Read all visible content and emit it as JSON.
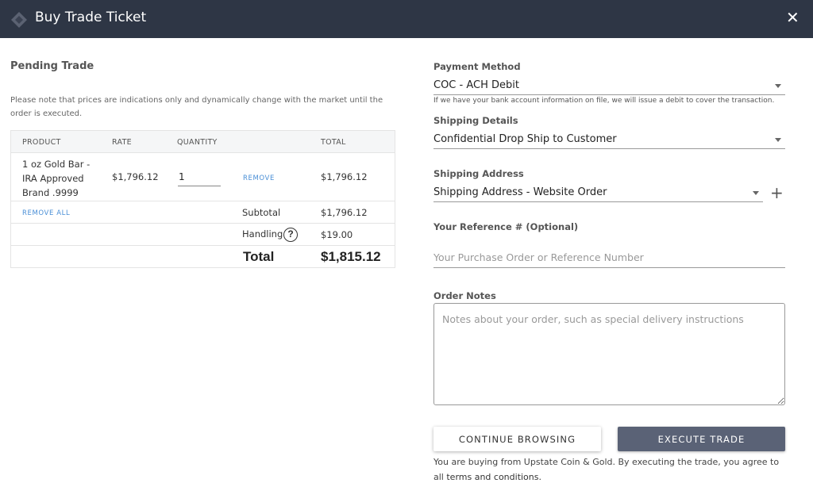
{
  "header": {
    "title": "Buy Trade Ticket",
    "close_label": "✕",
    "logo_icon": "diamond-logo-icon"
  },
  "pending": {
    "title": "Pending Trade",
    "note": "Please note that prices are indications only and dynamically change with the market until the order is executed.",
    "columns": [
      "PRODUCT",
      "RATE",
      "QUANTITY",
      "TOTAL"
    ],
    "item": {
      "product": "1 oz Gold Bar - IRA Approved Brand .9999",
      "rate": "$1,796.12",
      "quantity": "1",
      "remove_label": "REMOVE",
      "total": "$1,796.12"
    },
    "remove_all_label": "REMOVE ALL",
    "subtotal_label": "Subtotal",
    "subtotal_value": "$1,796.12",
    "handling_label": "Handling",
    "handling_help": "?",
    "handling_value": "$19.00",
    "total_label": "Total",
    "total_value": "$1,815.12"
  },
  "payment": {
    "label": "Payment Method",
    "value": "COC - ACH Debit",
    "helper": "If we have your bank account information on file, we will issue a debit to cover the transaction."
  },
  "shipping_details": {
    "label": "Shipping Details",
    "value": "Confidential Drop Ship to Customer"
  },
  "shipping_address": {
    "label": "Shipping Address",
    "value": "Shipping Address - Website Order",
    "add_label": "+"
  },
  "reference": {
    "label": "Your Reference # (Optional)",
    "placeholder": "Your Purchase Order or Reference Number"
  },
  "order_notes": {
    "label": "Order Notes",
    "placeholder": "Notes about your order, such as special delivery instructions"
  },
  "actions": {
    "continue_label": "CONTINUE BROWSING",
    "execute_label": "EXECUTE TRADE"
  },
  "footer": {
    "text": "You are buying from Upstate Coin & Gold. By executing the trade, you agree to all",
    "terms_link": "terms and conditions."
  },
  "colors": {
    "header_bg": "#2e3645",
    "execute_bg": "#5a6276",
    "link": "#4a8fd6"
  }
}
